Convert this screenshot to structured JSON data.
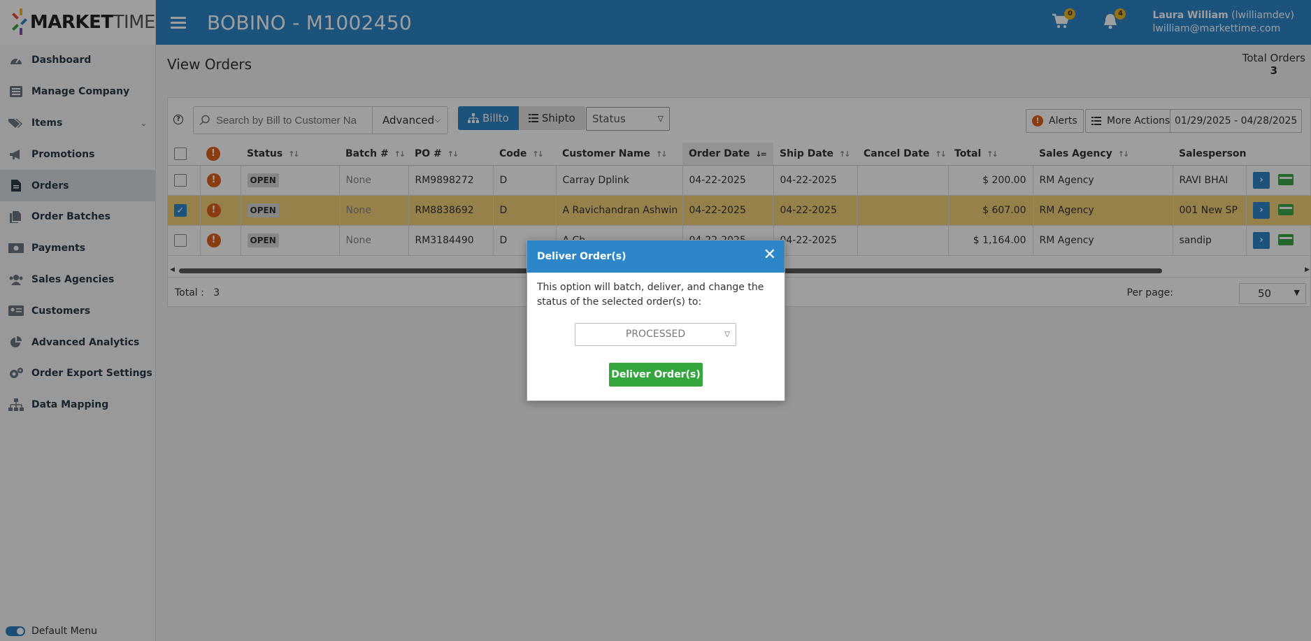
{
  "app": {
    "logo_bold": "MARKET",
    "logo_light": "TIME"
  },
  "header": {
    "title": "BOBINO - M1002450",
    "cart_count": "0",
    "notification_count": "4",
    "user_name": "Laura William",
    "user_handle": "(lwilliamdev)",
    "user_email": "lwilliam@markettime.com"
  },
  "sidebar": {
    "items": [
      {
        "label": "Dashboard",
        "icon": "speedometer-icon"
      },
      {
        "label": "Manage Company",
        "icon": "list-icon"
      },
      {
        "label": "Items",
        "icon": "tags-icon"
      },
      {
        "label": "Promotions",
        "icon": "megaphone-icon"
      },
      {
        "label": "Orders",
        "icon": "document-icon"
      },
      {
        "label": "Order Batches",
        "icon": "documents-icon"
      },
      {
        "label": "Payments",
        "icon": "money-icon"
      },
      {
        "label": "Sales Agencies",
        "icon": "users-icon"
      },
      {
        "label": "Customers",
        "icon": "id-card-icon"
      },
      {
        "label": "Advanced Analytics",
        "icon": "pie-chart-icon"
      },
      {
        "label": "Order Export Settings",
        "icon": "gears-icon"
      },
      {
        "label": "Data Mapping",
        "icon": "sitemap-icon"
      }
    ],
    "active_index": 4,
    "default_menu_label": "Default Menu"
  },
  "page": {
    "title": "View Orders",
    "total_orders_label": "Total Orders",
    "total_orders_value": "3"
  },
  "toolbar": {
    "search_placeholder": "Search by Bill to Customer Na",
    "advanced_label": "Advanced",
    "billto_label": "Billto",
    "shipto_label": "Shipto",
    "status_label": "Status",
    "alerts_label": "Alerts",
    "more_actions_label": "More Actions",
    "date_range": "01/29/2025 - 04/28/2025"
  },
  "table": {
    "columns": [
      "Status",
      "Batch #",
      "PO #",
      "Code",
      "Customer Name",
      "Order Date",
      "Ship Date",
      "Cancel Date",
      "Total",
      "Sales Agency",
      "Salesperson"
    ],
    "rows": [
      {
        "status": "OPEN",
        "batch": "None",
        "po": "RM9898272",
        "code": "D",
        "customer": "Carray Dplink",
        "order_date": "04-22-2025",
        "ship_date": "04-22-2025",
        "cancel_date": "",
        "total": "$ 200.00",
        "agency": "RM Agency",
        "salesperson": "RAVI BHAI",
        "selected": false
      },
      {
        "status": "OPEN",
        "batch": "None",
        "po": "RM8838692",
        "code": "D",
        "customer": "A Ravichandran Ashwin",
        "order_date": "04-22-2025",
        "ship_date": "04-22-2025",
        "cancel_date": "",
        "total": "$ 607.00",
        "agency": "RM Agency",
        "salesperson": "001 New SP",
        "selected": true
      },
      {
        "status": "OPEN",
        "batch": "None",
        "po": "RM3184490",
        "code": "D",
        "customer": "A Ch...",
        "order_date": "04-22-2025",
        "ship_date": "04-22-2025",
        "cancel_date": "",
        "total": "$ 1,164.00",
        "agency": "RM Agency",
        "salesperson": "sandip",
        "selected": false
      }
    ]
  },
  "footer": {
    "total_label": "Total :",
    "total_value": "3",
    "per_page_label": "Per page:",
    "per_page_value": "50"
  },
  "modal": {
    "title": "Deliver Order(s)",
    "message": "This option will batch, deliver, and change the status of the selected order(s) to:",
    "selected_status": "PROCESSED",
    "submit_label": "Deliver Order(s)"
  },
  "colors": {
    "primary": "#2c86c8",
    "selected_row": "#f2d17a",
    "success": "#35a63e",
    "alert": "#e0601a",
    "badge": "#f0b323"
  }
}
